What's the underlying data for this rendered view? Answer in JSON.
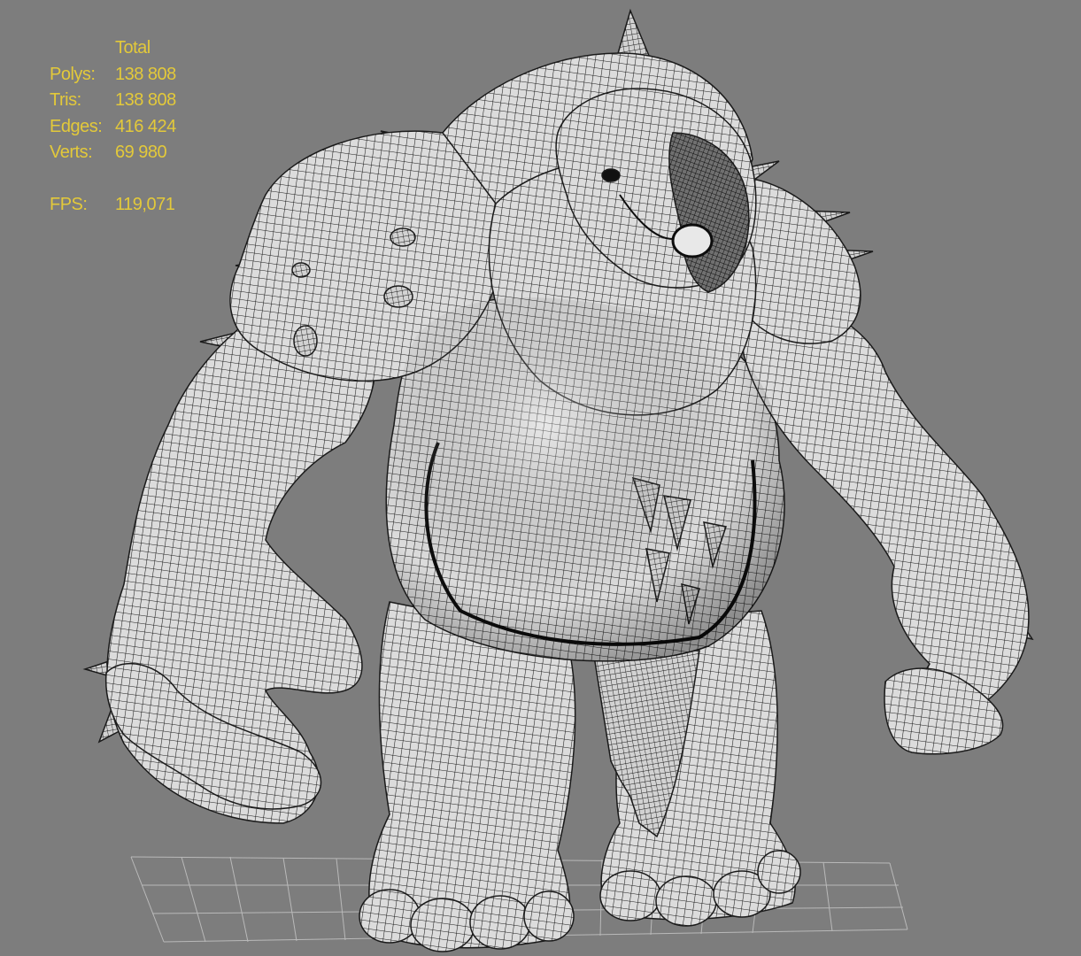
{
  "viewport": {
    "background_color": "#7d7d7d",
    "grid_color": "#b8b8b8",
    "mesh_fill_color": "#d9d9d9",
    "wire_color": "#1a1a1a",
    "shading": "smooth + edged faces"
  },
  "stats": {
    "header": "Total",
    "color": "#e3c93a",
    "polys_label": "Polys:",
    "polys_value": "138 808",
    "tris_label": "Tris:",
    "tris_value": "138 808",
    "edges_label": "Edges:",
    "edges_value": "416 424",
    "verts_label": "Verts:",
    "verts_value": "69 980",
    "fps_label": "FPS:",
    "fps_value": "119,071"
  }
}
